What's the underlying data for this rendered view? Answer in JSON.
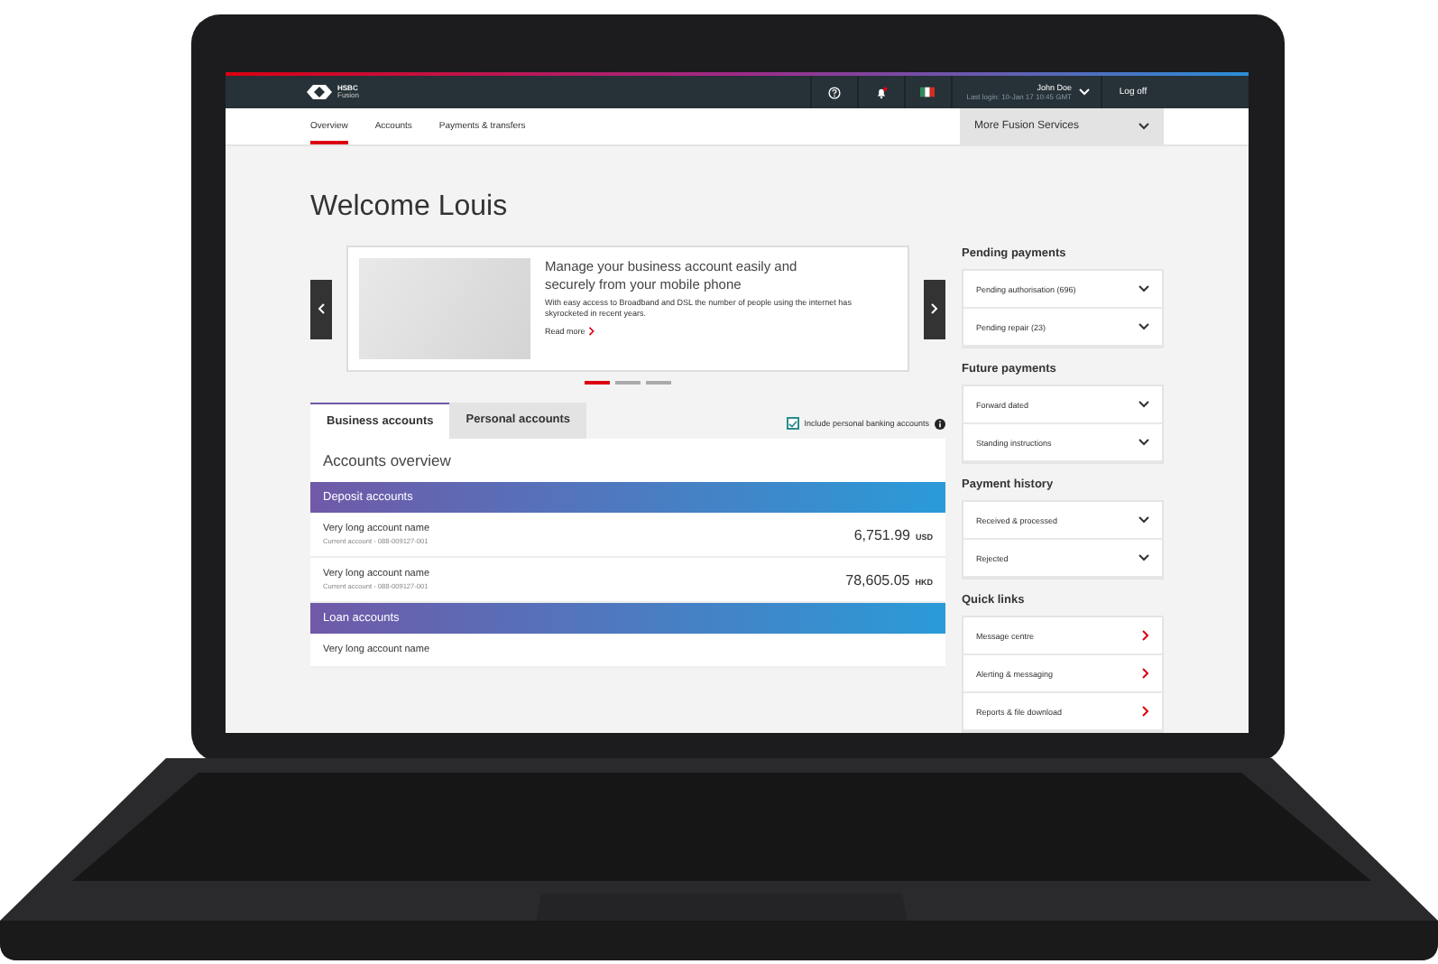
{
  "header": {
    "brand": "HSBC",
    "brand_sub": "Fusion",
    "user_name": "John Doe",
    "last_login": "Last login: 10-Jan 17 10:45 GMT",
    "logoff": "Log off",
    "notification": true
  },
  "nav": {
    "tabs": [
      {
        "label": "Overview",
        "selected": true
      },
      {
        "label": "Accounts",
        "selected": false
      },
      {
        "label": "Payments & transfers",
        "selected": false
      }
    ],
    "more_services": "More Fusion Services"
  },
  "welcome": "Welcome Louis",
  "carousel": {
    "title": "Manage your business account easily and securely from your mobile phone",
    "body": "With easy access to Broadband and DSL the number of people using the internet has skyrocketed in recent years.",
    "link": "Read more",
    "dots": [
      {
        "selected": true
      },
      {
        "selected": false
      },
      {
        "selected": false
      }
    ]
  },
  "accounts": {
    "tabs": [
      {
        "label": "Business accounts",
        "selected": true
      },
      {
        "label": "Personal accounts",
        "selected": false
      }
    ],
    "include": {
      "label": "Include personal banking accounts",
      "checked": true
    },
    "overview_title": "Accounts overview",
    "groups": [
      {
        "title": "Deposit accounts",
        "accounts": [
          {
            "name": "Very long account name",
            "detail": "Current account  -  088-009127-001",
            "amount": "6,751.99",
            "currency": "USD"
          },
          {
            "name": "Very long account name",
            "detail": "Current account  -  088-009127-001",
            "amount": "78,605.05",
            "currency": "HKD"
          }
        ]
      },
      {
        "title": "Loan accounts",
        "accounts": [
          {
            "name": "Very long account name"
          }
        ]
      }
    ]
  },
  "sidebar": [
    {
      "title": "Pending payments",
      "items": [
        {
          "label": "Pending authorisation (696)",
          "kind": "dropdown"
        },
        {
          "label": "Pending repair (23)",
          "kind": "dropdown"
        }
      ]
    },
    {
      "title": "Future payments",
      "items": [
        {
          "label": "Forward dated",
          "kind": "dropdown"
        },
        {
          "label": "Standing instructions",
          "kind": "dropdown"
        }
      ]
    },
    {
      "title": "Payment history",
      "items": [
        {
          "label": "Received & processed",
          "kind": "dropdown"
        },
        {
          "label": "Rejected",
          "kind": "dropdown"
        }
      ]
    },
    {
      "title": "Quick links",
      "items": [
        {
          "label": "Message centre",
          "kind": "link"
        },
        {
          "label": "Alerting & messaging",
          "kind": "link"
        },
        {
          "label": "Reports & file download",
          "kind": "link"
        }
      ]
    }
  ]
}
